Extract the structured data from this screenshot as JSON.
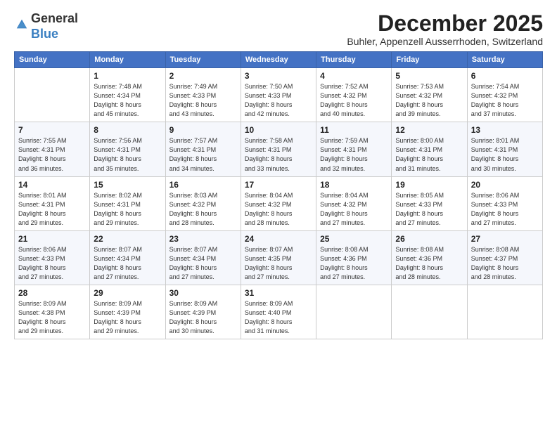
{
  "header": {
    "logo_line1": "General",
    "logo_line2": "Blue",
    "month": "December 2025",
    "location": "Buhler, Appenzell Ausserrhoden, Switzerland"
  },
  "weekdays": [
    "Sunday",
    "Monday",
    "Tuesday",
    "Wednesday",
    "Thursday",
    "Friday",
    "Saturday"
  ],
  "weeks": [
    [
      {
        "day": "",
        "info": ""
      },
      {
        "day": "1",
        "info": "Sunrise: 7:48 AM\nSunset: 4:34 PM\nDaylight: 8 hours\nand 45 minutes."
      },
      {
        "day": "2",
        "info": "Sunrise: 7:49 AM\nSunset: 4:33 PM\nDaylight: 8 hours\nand 43 minutes."
      },
      {
        "day": "3",
        "info": "Sunrise: 7:50 AM\nSunset: 4:33 PM\nDaylight: 8 hours\nand 42 minutes."
      },
      {
        "day": "4",
        "info": "Sunrise: 7:52 AM\nSunset: 4:32 PM\nDaylight: 8 hours\nand 40 minutes."
      },
      {
        "day": "5",
        "info": "Sunrise: 7:53 AM\nSunset: 4:32 PM\nDaylight: 8 hours\nand 39 minutes."
      },
      {
        "day": "6",
        "info": "Sunrise: 7:54 AM\nSunset: 4:32 PM\nDaylight: 8 hours\nand 37 minutes."
      }
    ],
    [
      {
        "day": "7",
        "info": "Sunrise: 7:55 AM\nSunset: 4:31 PM\nDaylight: 8 hours\nand 36 minutes."
      },
      {
        "day": "8",
        "info": "Sunrise: 7:56 AM\nSunset: 4:31 PM\nDaylight: 8 hours\nand 35 minutes."
      },
      {
        "day": "9",
        "info": "Sunrise: 7:57 AM\nSunset: 4:31 PM\nDaylight: 8 hours\nand 34 minutes."
      },
      {
        "day": "10",
        "info": "Sunrise: 7:58 AM\nSunset: 4:31 PM\nDaylight: 8 hours\nand 33 minutes."
      },
      {
        "day": "11",
        "info": "Sunrise: 7:59 AM\nSunset: 4:31 PM\nDaylight: 8 hours\nand 32 minutes."
      },
      {
        "day": "12",
        "info": "Sunrise: 8:00 AM\nSunset: 4:31 PM\nDaylight: 8 hours\nand 31 minutes."
      },
      {
        "day": "13",
        "info": "Sunrise: 8:01 AM\nSunset: 4:31 PM\nDaylight: 8 hours\nand 30 minutes."
      }
    ],
    [
      {
        "day": "14",
        "info": "Sunrise: 8:01 AM\nSunset: 4:31 PM\nDaylight: 8 hours\nand 29 minutes."
      },
      {
        "day": "15",
        "info": "Sunrise: 8:02 AM\nSunset: 4:31 PM\nDaylight: 8 hours\nand 29 minutes."
      },
      {
        "day": "16",
        "info": "Sunrise: 8:03 AM\nSunset: 4:32 PM\nDaylight: 8 hours\nand 28 minutes."
      },
      {
        "day": "17",
        "info": "Sunrise: 8:04 AM\nSunset: 4:32 PM\nDaylight: 8 hours\nand 28 minutes."
      },
      {
        "day": "18",
        "info": "Sunrise: 8:04 AM\nSunset: 4:32 PM\nDaylight: 8 hours\nand 27 minutes."
      },
      {
        "day": "19",
        "info": "Sunrise: 8:05 AM\nSunset: 4:33 PM\nDaylight: 8 hours\nand 27 minutes."
      },
      {
        "day": "20",
        "info": "Sunrise: 8:06 AM\nSunset: 4:33 PM\nDaylight: 8 hours\nand 27 minutes."
      }
    ],
    [
      {
        "day": "21",
        "info": "Sunrise: 8:06 AM\nSunset: 4:33 PM\nDaylight: 8 hours\nand 27 minutes."
      },
      {
        "day": "22",
        "info": "Sunrise: 8:07 AM\nSunset: 4:34 PM\nDaylight: 8 hours\nand 27 minutes."
      },
      {
        "day": "23",
        "info": "Sunrise: 8:07 AM\nSunset: 4:34 PM\nDaylight: 8 hours\nand 27 minutes."
      },
      {
        "day": "24",
        "info": "Sunrise: 8:07 AM\nSunset: 4:35 PM\nDaylight: 8 hours\nand 27 minutes."
      },
      {
        "day": "25",
        "info": "Sunrise: 8:08 AM\nSunset: 4:36 PM\nDaylight: 8 hours\nand 27 minutes."
      },
      {
        "day": "26",
        "info": "Sunrise: 8:08 AM\nSunset: 4:36 PM\nDaylight: 8 hours\nand 28 minutes."
      },
      {
        "day": "27",
        "info": "Sunrise: 8:08 AM\nSunset: 4:37 PM\nDaylight: 8 hours\nand 28 minutes."
      }
    ],
    [
      {
        "day": "28",
        "info": "Sunrise: 8:09 AM\nSunset: 4:38 PM\nDaylight: 8 hours\nand 29 minutes."
      },
      {
        "day": "29",
        "info": "Sunrise: 8:09 AM\nSunset: 4:39 PM\nDaylight: 8 hours\nand 29 minutes."
      },
      {
        "day": "30",
        "info": "Sunrise: 8:09 AM\nSunset: 4:39 PM\nDaylight: 8 hours\nand 30 minutes."
      },
      {
        "day": "31",
        "info": "Sunrise: 8:09 AM\nSunset: 4:40 PM\nDaylight: 8 hours\nand 31 minutes."
      },
      {
        "day": "",
        "info": ""
      },
      {
        "day": "",
        "info": ""
      },
      {
        "day": "",
        "info": ""
      }
    ]
  ]
}
